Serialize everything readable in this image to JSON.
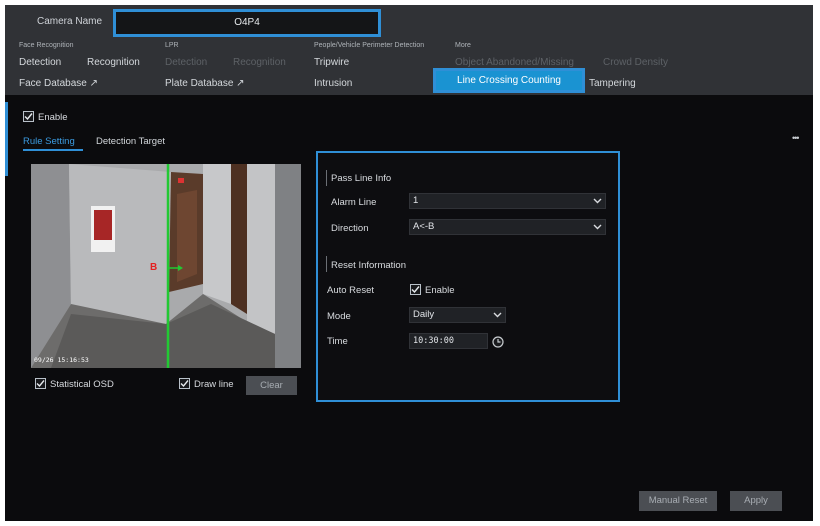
{
  "header": {
    "camera_name_label": "Camera Name",
    "camera_name_value": "O4P4"
  },
  "menu": {
    "groups": [
      {
        "title": "Face Recognition",
        "items": [
          "Detection",
          "Recognition",
          "Face Database ↗"
        ]
      },
      {
        "title": "LPR",
        "items": [
          "Detection",
          "Recognition",
          "Plate Database ↗"
        ]
      },
      {
        "title": "People/Vehicle Perimeter Detection",
        "items": [
          "Tripwire",
          "Intrusion"
        ]
      },
      {
        "title": "More",
        "items": [
          "Object Abandoned/Missing",
          "Crowd Density",
          "Line Crossing Counting",
          "Tampering"
        ]
      }
    ],
    "active_item": "Line Crossing Counting"
  },
  "enable": {
    "label": "Enable",
    "checked": true
  },
  "tabs": [
    {
      "label": "Rule Setting",
      "active": true
    },
    {
      "label": "Detection Target",
      "active": false
    }
  ],
  "more_menu": "•••",
  "preview": {
    "timestamp": "09/26 15:16:53",
    "line_label": "B",
    "statistical_osd": {
      "label": "Statistical OSD",
      "checked": true
    },
    "draw_line": {
      "label": "Draw line",
      "checked": true
    },
    "clear_button": "Clear"
  },
  "settings": {
    "pass_line_header": "Pass Line Info",
    "alarm_line_label": "Alarm Line",
    "alarm_line_value": "1",
    "direction_label": "Direction",
    "direction_value": "A<-B",
    "reset_header": "Reset Information",
    "auto_reset_label": "Auto Reset",
    "auto_reset_enable": "Enable",
    "auto_reset_checked": true,
    "mode_label": "Mode",
    "mode_value": "Daily",
    "time_label": "Time",
    "time_value": "10:30:00"
  },
  "footer": {
    "manual_reset": "Manual Reset",
    "apply": "Apply"
  },
  "colors": {
    "accent": "#2f8fd6",
    "highlight_fill": "#1d9ad8",
    "background": "#0b0b0d",
    "green_line": "#22c933",
    "red_label": "#e32020"
  }
}
